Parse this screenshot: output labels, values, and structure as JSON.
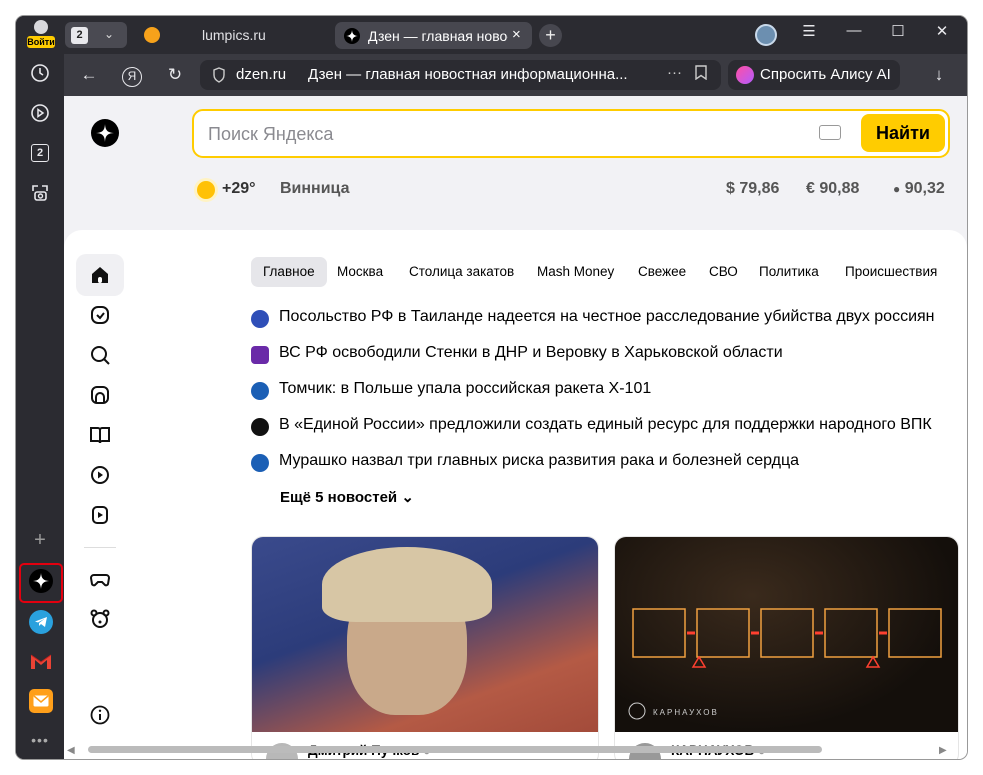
{
  "rail": {
    "login_label": "Войти",
    "items": [
      "history-icon",
      "play-circle-icon",
      "tabs-count-icon",
      "screenshot-icon"
    ],
    "tabs_count": "2",
    "apps": [
      "add-icon",
      "dzen-icon",
      "telegram-icon",
      "gmail-icon",
      "mail-icon",
      "more-icon"
    ]
  },
  "tabbar": {
    "tab_count": "2",
    "tabs": [
      {
        "title": "lumpics.ru"
      },
      {
        "title": "Дзен — главная новости"
      }
    ],
    "close_label": "×",
    "new_tab_label": "+",
    "window_controls": {
      "menu": "☰",
      "minimize": "—",
      "maximize": "☐",
      "close": "✕"
    }
  },
  "navbar": {
    "back": "←",
    "yandex": "Я",
    "reload": "↻",
    "domain": "dzen.ru",
    "page_title": "Дзен — главная новостная информационна...",
    "more": "···",
    "alice_label": "Спросить Алису AI",
    "download": "↓"
  },
  "search": {
    "placeholder": "Поиск Яндекса",
    "button": "Найти"
  },
  "infobar": {
    "temp": "+29°",
    "city": "Винница",
    "usd": "$ 79,86",
    "eur": "€ 90,88",
    "oil": "90,32"
  },
  "chips": [
    "Главное",
    "Москва",
    "Столица закатов",
    "Mash Money",
    "Свежее",
    "СВО",
    "Политика",
    "Происшествия"
  ],
  "news": [
    {
      "text": "Посольство РФ в Таиланде надеется на честное расследование убийства двух россиян",
      "color": "#2f4fb8"
    },
    {
      "text": "ВС РФ освободили Стенки в ДНР и Веровку в Харьковской области",
      "color": "#6a2aa8"
    },
    {
      "text": "Томчик: в Польше упала российская ракета Х-101",
      "color": "#1b5fb5"
    },
    {
      "text": "В «Единой России» предложили создать единый ресурс для поддержки народного ВПК",
      "color": "#111111"
    },
    {
      "text": "Мурашко назвал три главных риска развития рака и болезней сердца",
      "color": "#1b5fb5"
    }
  ],
  "more_news": "Ещё 5 новостей",
  "cards": [
    {
      "author": "Дмитрий Пучков"
    },
    {
      "author": "КАРНАУХОВ",
      "brand": "КАРНАУХОВ"
    }
  ]
}
